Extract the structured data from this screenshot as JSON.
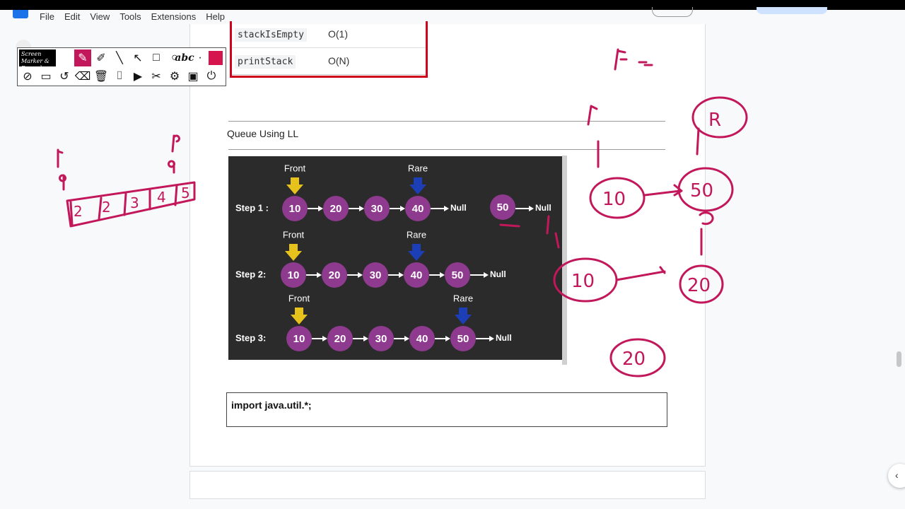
{
  "menu": {
    "items": [
      "File",
      "Edit",
      "View",
      "Tools",
      "Extensions",
      "Help"
    ]
  },
  "complexity_table": {
    "rows": [
      {
        "op": "stackIsEmpty",
        "complexity": "O(1)"
      },
      {
        "op": "printStack",
        "complexity": "O(N)"
      }
    ]
  },
  "section": {
    "title": "Queue Using LL"
  },
  "queue_diagram": {
    "front_label": "Front",
    "rear_label": "Rare",
    "null_label": "Null",
    "steps": [
      {
        "label": "Step 1 :",
        "nodes": [
          "10",
          "20",
          "30",
          "40"
        ],
        "extra_node": "50"
      },
      {
        "label": "Step 2:",
        "nodes": [
          "10",
          "20",
          "30",
          "40",
          "50"
        ]
      },
      {
        "label": "Step 3:",
        "nodes": [
          "10",
          "20",
          "30",
          "40",
          "50"
        ]
      }
    ]
  },
  "code": {
    "text": "import java.util.*;"
  },
  "toolbar": {
    "logo": "Screen Marker & Recorder",
    "text_tool": "abc",
    "color": "#d6154f"
  },
  "annotations": {
    "color": "#c2185b",
    "labels": [
      "f",
      "f",
      "R",
      "F",
      "F --",
      "10",
      "50",
      "R",
      "10",
      "20",
      "20",
      "f"
    ],
    "array_values": [
      "2",
      "2",
      "3",
      "4",
      "5"
    ]
  }
}
